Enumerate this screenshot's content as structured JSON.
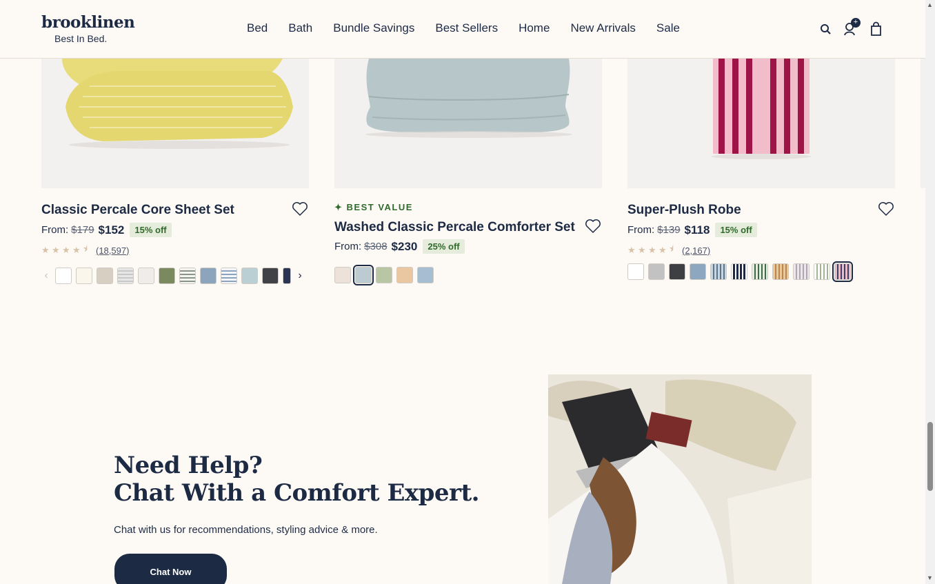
{
  "header": {
    "logo": "brooklinen",
    "tagline": "Best In Bed.",
    "nav": [
      "Bed",
      "Bath",
      "Bundle Savings",
      "Best Sellers",
      "Home",
      "New Arrivals",
      "Sale"
    ],
    "account_badge": "+",
    "icons": [
      "search-icon",
      "account-icon",
      "bag-icon"
    ]
  },
  "products": [
    {
      "title": "Classic Percale Core Sheet Set",
      "from_label": "From:",
      "original_price": "$179",
      "sale_price": "$152",
      "discount": "15% off",
      "rating": 4.5,
      "reviews": "(18,597)",
      "swatches": [
        "#ffffff",
        "#faf6ec",
        "#d7cfc2",
        "stripe-gray",
        "#f0ecea",
        "#7a8a5e",
        "stripe-sage",
        "#8da4bd",
        "stripe-blue",
        "#b9cfd3",
        "#404248",
        "#2a3552"
      ]
    },
    {
      "badge": "BEST VALUE",
      "title": "Washed Classic Percale Comforter Set",
      "from_label": "From:",
      "original_price": "$308",
      "sale_price": "$230",
      "discount": "25% off",
      "swatches": [
        "#ece2da",
        "#bccbd2",
        "#b9c6a4",
        "#eac7a1",
        "#a6bdd2"
      ],
      "selected_swatch": 1
    },
    {
      "title": "Super-Plush Robe",
      "from_label": "From:",
      "original_price": "$139",
      "sale_price": "$118",
      "discount": "15% off",
      "rating": 4.5,
      "reviews": "(2,167)",
      "swatches": [
        "#ffffff",
        "#c2c2c2",
        "#3e3f42",
        "#8ea7c1",
        "stripe-lightblue",
        "stripe-navy",
        "stripe-green",
        "stripe-tan",
        "stripe-pinkgray",
        "stripe-greenwhite",
        "stripe-pinknavy"
      ],
      "selected_swatch": 10
    }
  ],
  "help": {
    "title_line1": "Need Help?",
    "title_line2": "Chat With a Comfort Expert.",
    "subtitle": "Chat with us for recommendations, styling advice & more.",
    "button": "Chat Now"
  },
  "colors": {
    "navy": "#1d2a44",
    "background": "#fdfaf6",
    "discount_green": "#2f6a2a",
    "discount_bg": "#e6ecdc"
  }
}
